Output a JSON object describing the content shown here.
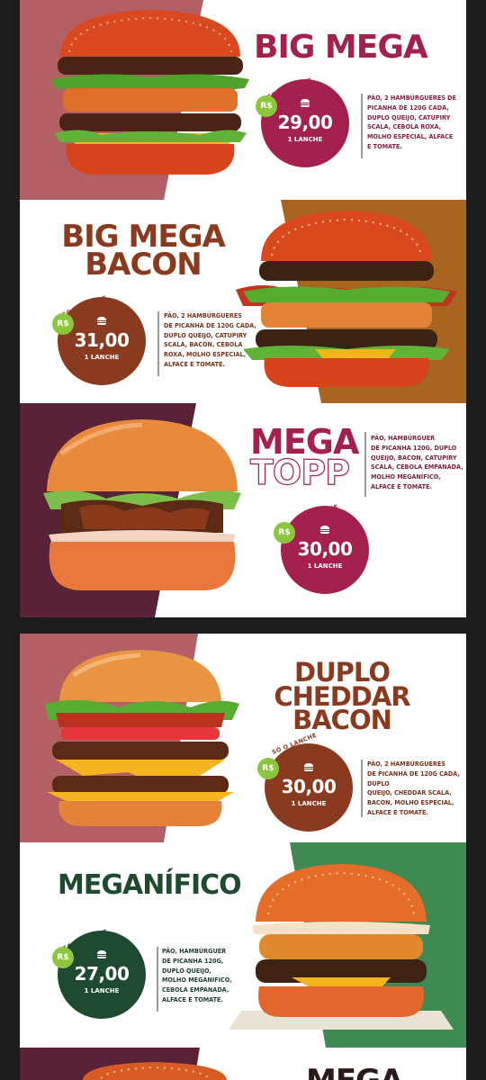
{
  "colors": {
    "magenta": "#a3204f",
    "brown": "#8a3b1f",
    "purple": "#5a2238",
    "rose": "#b35f66",
    "gold": "#a8651f",
    "green": "#3e8a52",
    "dark_green": "#1e4a30",
    "lime": "#8cc63f"
  },
  "tag_text": "SÓ O LANCHE",
  "currency": "R$",
  "unit_label": "1 LANCHE",
  "items": [
    {
      "name": "BIG MEGA",
      "price": "29,00",
      "desc": [
        "PÃO, 2 HAMBÚRGUERES DE",
        "PICANHA DE 120G CADA,",
        "DUPLO QUEIJO, CATUPIRY",
        "SCALA, CEBOLA ROXA,",
        "MOLHO ESPECIAL, ALFACE",
        "E TOMATE."
      ]
    },
    {
      "name_line1": "BIG MEGA",
      "name_line2": "BACON",
      "price": "31,00",
      "desc": [
        "PÃO, 2 HAMBÚRGUERES",
        "DE PICANHA DE 120G CADA,",
        "DUPLO QUEIJO, CATUPIRY",
        "SCALA, BACON, CEBOLA",
        "ROXA, MOLHO ESPECIAL,",
        "ALFACE E TOMATE."
      ]
    },
    {
      "name_line1": "MEGA",
      "name_line2": "TOPP",
      "price": "30,00",
      "desc": [
        "PÃO, HAMBÚRGUER",
        "DE PICANHA 120G, DUPLO",
        "QUEIJO, BACON, CATUPIRY",
        "SCALA, CEBOLA EMPANADA,",
        "MOLHO MEGANÍFICO,",
        "ALFACE E TOMATE."
      ]
    },
    {
      "name_line1": "DUPLO",
      "name_line2": "CHEDDAR",
      "name_line3": "BACON",
      "price": "30,00",
      "desc": [
        "PÃO, 2 HAMBÚRGUERES",
        "DE PICANHA DE 120G CADA, DUPLO",
        "QUEIJO, CHEDDAR SCALA,",
        "BACON, MOLHO ESPECIAL,",
        "ALFACE E TOMATE."
      ]
    },
    {
      "name": "MEGANÍFICO",
      "price": "27,00",
      "desc": [
        "PÃO, HAMBÚRGUER",
        "DE PICANHA 120G,",
        "DUPLO QUEIJO,",
        "MOLHO MEGANÍFICO,",
        "CEBOLA EMPANADA,",
        "ALFACE E TOMATE."
      ]
    },
    {
      "name": "MEGA"
    }
  ]
}
